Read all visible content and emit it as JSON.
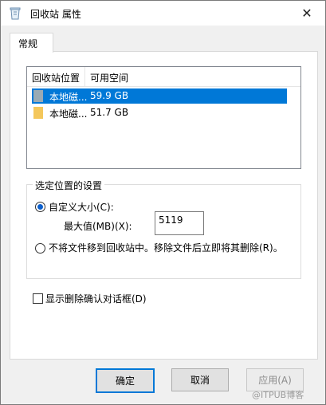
{
  "window": {
    "title": "回收站 属性",
    "close": "✕"
  },
  "tabs": [
    {
      "label": "常规",
      "active": true
    }
  ],
  "listview": {
    "headers": [
      "回收站位置",
      "可用空间"
    ],
    "rows": [
      {
        "name": "本地磁...",
        "space": "59.9 GB",
        "selected": true
      },
      {
        "name": "本地磁...",
        "space": "51.7 GB",
        "selected": false
      }
    ]
  },
  "settings": {
    "title": "选定位置的设置",
    "custom_label": "自定义大小(C):",
    "max_label": "最大值(MB)(X):",
    "max_value": "5119",
    "nomove_label": "不将文件移到回收站中。移除文件后立即将其删除(R)。"
  },
  "confirm_label": "显示删除确认对话框(D)",
  "buttons": {
    "ok": "确定",
    "cancel": "取消",
    "apply": "应用(A)"
  },
  "watermark": "@ITPUB博客",
  "colors": {
    "selection": "#0078d7",
    "folder": "#f4c75b",
    "drive": "#9aaab4"
  }
}
